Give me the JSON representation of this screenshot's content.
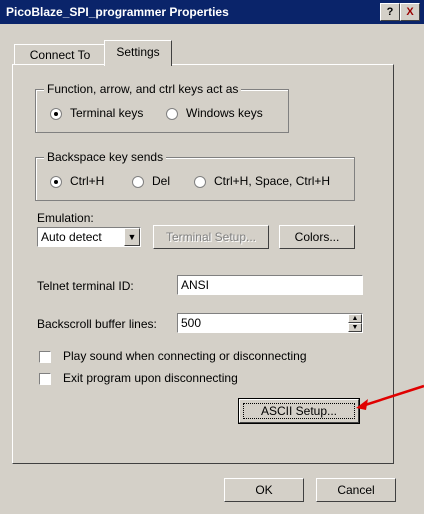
{
  "window": {
    "title": "PicoBlaze_SPI_programmer Properties",
    "help_button": "?",
    "close_button": "X"
  },
  "tabs": [
    {
      "label": "Connect To"
    },
    {
      "label": "Settings"
    }
  ],
  "function_keys": {
    "legend": "Function, arrow, and ctrl keys act as",
    "options": [
      {
        "label": "Terminal keys",
        "selected": true
      },
      {
        "label": "Windows keys",
        "selected": false
      }
    ]
  },
  "backspace": {
    "legend": "Backspace key sends",
    "options": [
      {
        "label": "Ctrl+H",
        "selected": true
      },
      {
        "label": "Del",
        "selected": false
      },
      {
        "label": "Ctrl+H, Space, Ctrl+H",
        "selected": false
      }
    ]
  },
  "emulation": {
    "label": "Emulation:",
    "value": "Auto detect",
    "terminal_setup": "Terminal Setup...",
    "colors": "Colors..."
  },
  "telnet": {
    "label": "Telnet terminal ID:",
    "value": "ANSI"
  },
  "backscroll": {
    "label": "Backscroll buffer lines:",
    "value": "500"
  },
  "checkboxes": [
    {
      "label": "Play sound when connecting or disconnecting",
      "checked": false
    },
    {
      "label": "Exit program upon disconnecting",
      "checked": false
    }
  ],
  "ascii_setup": "ASCII Setup...",
  "footer": {
    "ok": "OK",
    "cancel": "Cancel"
  },
  "colors": {
    "titlebar": "#0a246a",
    "face": "#d4d0c8",
    "annotation_arrow": "#e00000"
  }
}
